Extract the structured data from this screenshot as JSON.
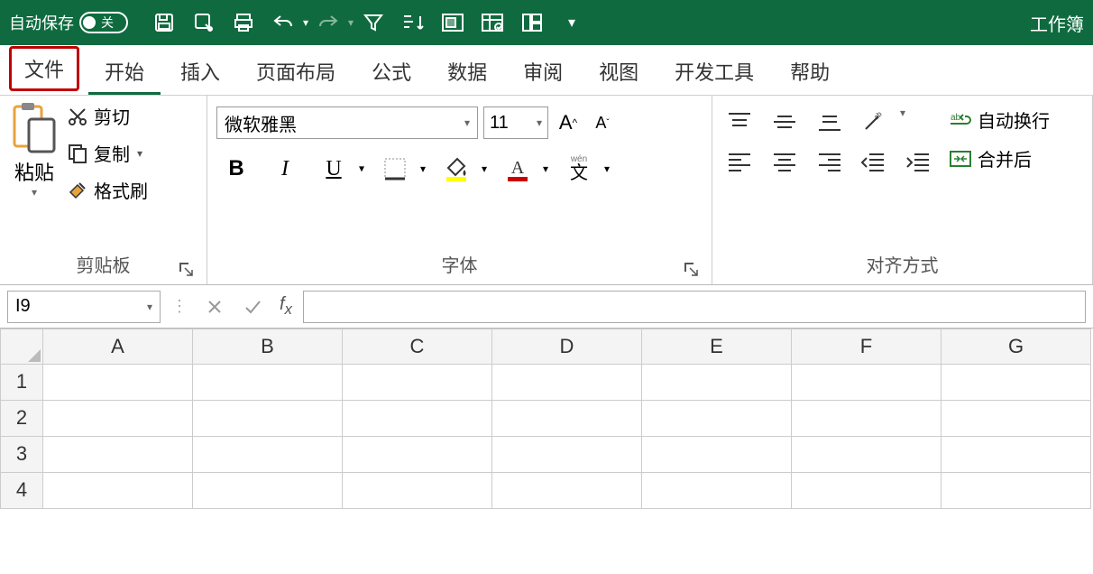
{
  "titlebar": {
    "autosave_label": "自动保存",
    "autosave_state": "关",
    "app_title": "工作簿"
  },
  "tabs": {
    "file": "文件",
    "home": "开始",
    "insert": "插入",
    "layout": "页面布局",
    "formula": "公式",
    "data": "数据",
    "review": "审阅",
    "view": "视图",
    "dev": "开发工具",
    "help": "帮助"
  },
  "clipboard": {
    "paste": "粘贴",
    "cut": "剪切",
    "copy": "复制",
    "format_painter": "格式刷",
    "group_label": "剪贴板"
  },
  "font": {
    "name": "微软雅黑",
    "size": "11",
    "ruby_text": "wén",
    "ruby_char": "文",
    "group_label": "字体"
  },
  "alignment": {
    "wrap": "自动换行",
    "merge": "合并后",
    "group_label": "对齐方式"
  },
  "formula_bar": {
    "name_box": "I9"
  },
  "columns": [
    "A",
    "B",
    "C",
    "D",
    "E",
    "F",
    "G"
  ],
  "rows": [
    "1",
    "2",
    "3",
    "4"
  ]
}
